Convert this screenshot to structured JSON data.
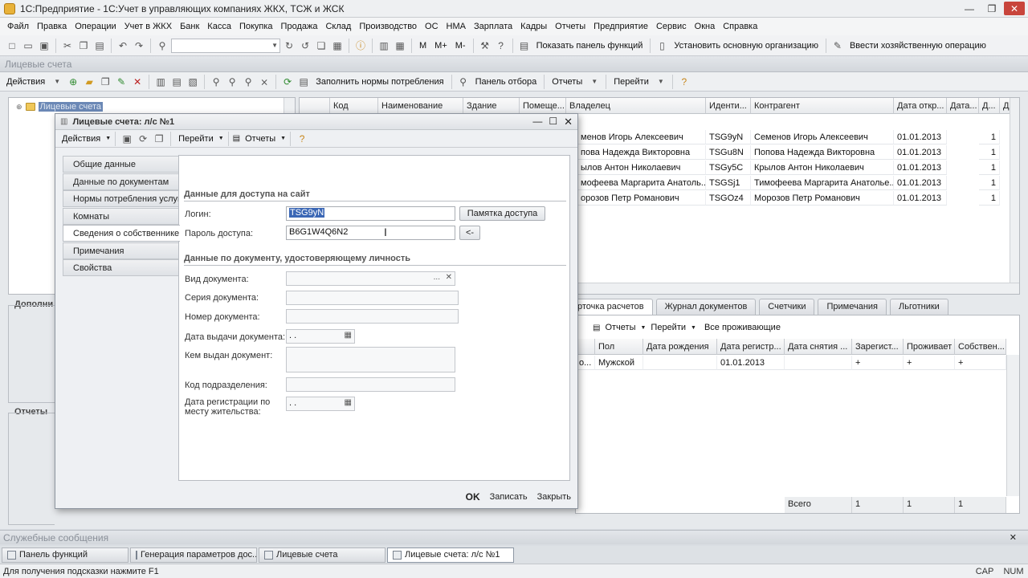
{
  "app": {
    "title": "1С:Предприятие - 1С:Учет в управляющих компаниях ЖКХ, ТСЖ и ЖСК",
    "min": "—",
    "max": "❐",
    "close": "✕"
  },
  "menu": [
    "Файл",
    "Правка",
    "Операции",
    "Учет в ЖКХ",
    "Банк",
    "Касса",
    "Покупка",
    "Продажа",
    "Склад",
    "Производство",
    "ОС",
    "НМА",
    "Зарплата",
    "Кадры",
    "Отчеты",
    "Предприятие",
    "Сервис",
    "Окна",
    "Справка"
  ],
  "toolbar": {
    "show_panel": "Показать панель функций",
    "set_org": "Установить основную организацию",
    "enter_op": "Ввести хозяйственную операцию",
    "m_label": "M",
    "mplus_label": "M+",
    "mminus_label": "M-"
  },
  "list": {
    "title": "Лицевые счета",
    "actions": "Действия",
    "fill_norms": "Заполнить нормы потребления",
    "filter_panel": "Панель отбора",
    "reports": "Отчеты",
    "goto": "Перейти",
    "tree_root": "Лицевые счета",
    "group_additional": "Дополни",
    "group_reports": "Отчеты",
    "columns": [
      "Код",
      "Наименование",
      "Здание",
      "Помеще...",
      "Владелец",
      "Иденти...",
      "Контрагент",
      "Дата откр...",
      "Дата...",
      "Д...",
      "Д"
    ],
    "rows": [
      {
        "owner": "менов Игорь Алексеевич",
        "ident": "TSG9yN",
        "contractor": "Семенов Игорь Алексеевич",
        "date": "01.01.2013",
        "d": "1"
      },
      {
        "owner": "пова Надежда Викторовна",
        "ident": "TSGu8N",
        "contractor": "Попова Надежда Викторовна",
        "date": "01.01.2013",
        "d": "1"
      },
      {
        "owner": "ылов Антон Николаевич",
        "ident": "TSGy5C",
        "contractor": "Крылов Антон Николаевич",
        "date": "01.01.2013",
        "d": "1"
      },
      {
        "owner": "мофеева Маргарита Анатоль...",
        "ident": "TSGSj1",
        "contractor": "Тимофеева Маргарита Анатолье...",
        "date": "01.01.2013",
        "d": "1"
      },
      {
        "owner": "орозов Петр Романович",
        "ident": "TSGOz4",
        "contractor": "Морозов Петр Романович",
        "date": "01.01.2013",
        "d": "1"
      }
    ]
  },
  "bottom_tabs": [
    "рточка расчетов",
    "Журнал документов",
    "Счетчики",
    "Примечания",
    "Льготники"
  ],
  "bottom": {
    "reports": "Отчеты",
    "goto": "Перейти",
    "all_residents": "Все проживающие",
    "columns": [
      "Пол",
      "Дата рождения",
      "Дата регистр...",
      "Дата снятия ...",
      "Зарегист...",
      "Проживает",
      "Собствен..."
    ],
    "row": {
      "first": "о...",
      "gender": "Мужской",
      "birth": "",
      "reg_date": "01.01.2013",
      "unreg": "",
      "registered": "+",
      "lives": "+",
      "owner": "+"
    },
    "total_label": "Всего",
    "totals": [
      "1",
      "1",
      "1"
    ]
  },
  "dialog": {
    "title": "Лицевые счета: л/с №1",
    "actions": "Действия",
    "goto": "Перейти",
    "reports": "Отчеты",
    "side_tabs": [
      "Общие данные",
      "Данные по документам",
      "Нормы потребления услуг",
      "Комнаты",
      "Сведения о собственнике",
      "Примечания",
      "Свойства"
    ],
    "active_tab_index": 4,
    "section_site": "Данные для доступа на сайт",
    "login_label": "Логин:",
    "login_value": "TSG9yN",
    "memo_button": "Памятка доступа",
    "password_label": "Пароль доступа:",
    "password_value": "B6G1W4Q6N2",
    "back_button": "<-",
    "section_doc": "Данные по документу, удостоверяющему личность",
    "doc_type_label": "Вид документа:",
    "doc_type_value": "",
    "series_label": "Серия документа:",
    "number_label": "Номер документа:",
    "issue_date_label": "Дата выдачи документа:",
    "issue_date_value": " .  .",
    "issued_by_label": "Кем выдан документ:",
    "dept_code_label": "Код подразделения:",
    "reg_date_label_1": "Дата регистрации по",
    "reg_date_label_2": "месту жительства:",
    "reg_date_value": " .  .",
    "ok": "OK",
    "save": "Записать",
    "close": "Закрыть"
  },
  "service_messages": "Служебные сообщения",
  "taskbar": [
    "Панель функций",
    "Генерация параметров дос...",
    "Лицевые счета",
    "Лицевые счета: л/с №1"
  ],
  "status": {
    "hint": "Для получения подсказки нажмите F1",
    "cap": "CAP",
    "num": "NUM"
  },
  "colors": {
    "selection": "#6b88b6",
    "close_red": "#c8453c"
  }
}
